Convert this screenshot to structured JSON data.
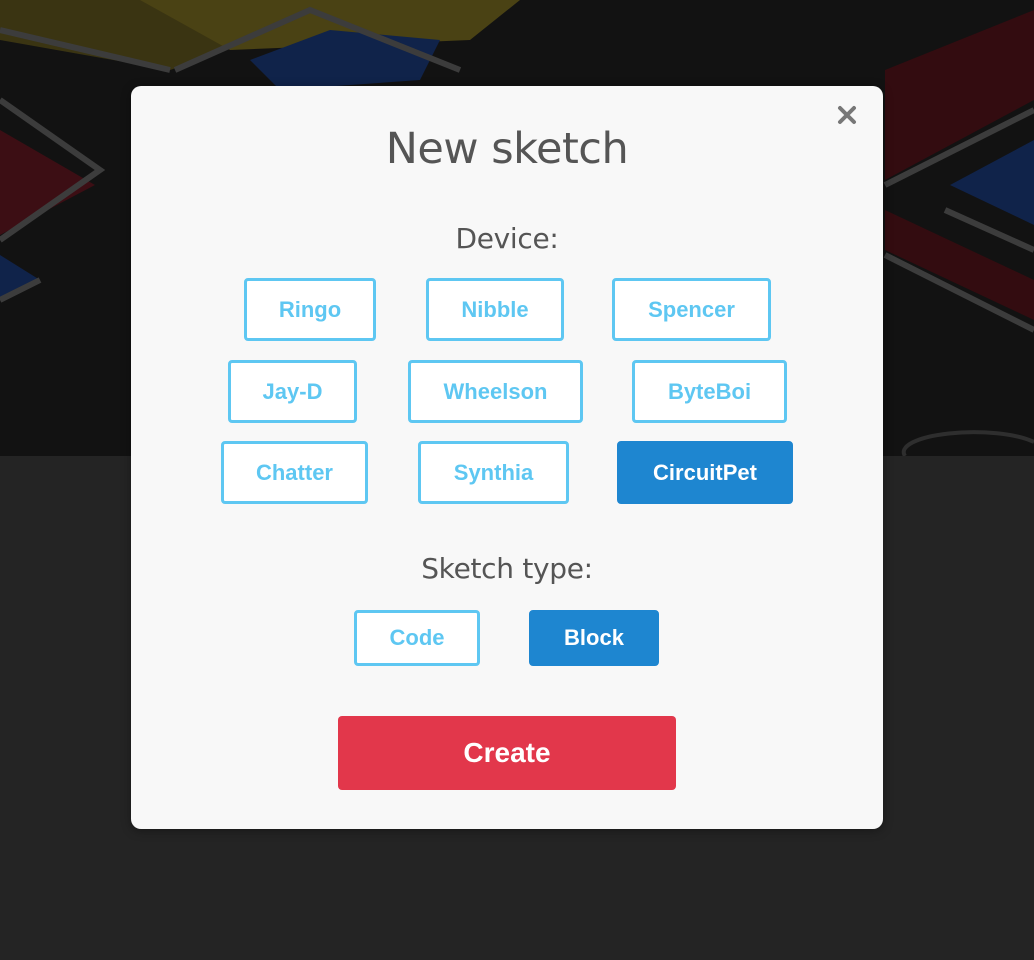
{
  "modal": {
    "title": "New sketch",
    "close_icon": "close-icon",
    "device_label": "Device:",
    "devices": [
      {
        "label": "Ringo",
        "selected": false
      },
      {
        "label": "Nibble",
        "selected": false
      },
      {
        "label": "Spencer",
        "selected": false
      },
      {
        "label": "Jay-D",
        "selected": false
      },
      {
        "label": "Wheelson",
        "selected": false
      },
      {
        "label": "ByteBoi",
        "selected": false
      },
      {
        "label": "Chatter",
        "selected": false
      },
      {
        "label": "Synthia",
        "selected": false
      },
      {
        "label": "CircuitPet",
        "selected": true
      }
    ],
    "sketch_type_label": "Sketch type:",
    "sketch_types": [
      {
        "label": "Code",
        "selected": false
      },
      {
        "label": "Block",
        "selected": true
      }
    ],
    "create_label": "Create"
  },
  "colors": {
    "accent_outline": "#5ec7f2",
    "selected_fill": "#1e86d0",
    "create_button": "#e2374b",
    "modal_background": "#f8f8f8",
    "page_background": "#242424"
  }
}
